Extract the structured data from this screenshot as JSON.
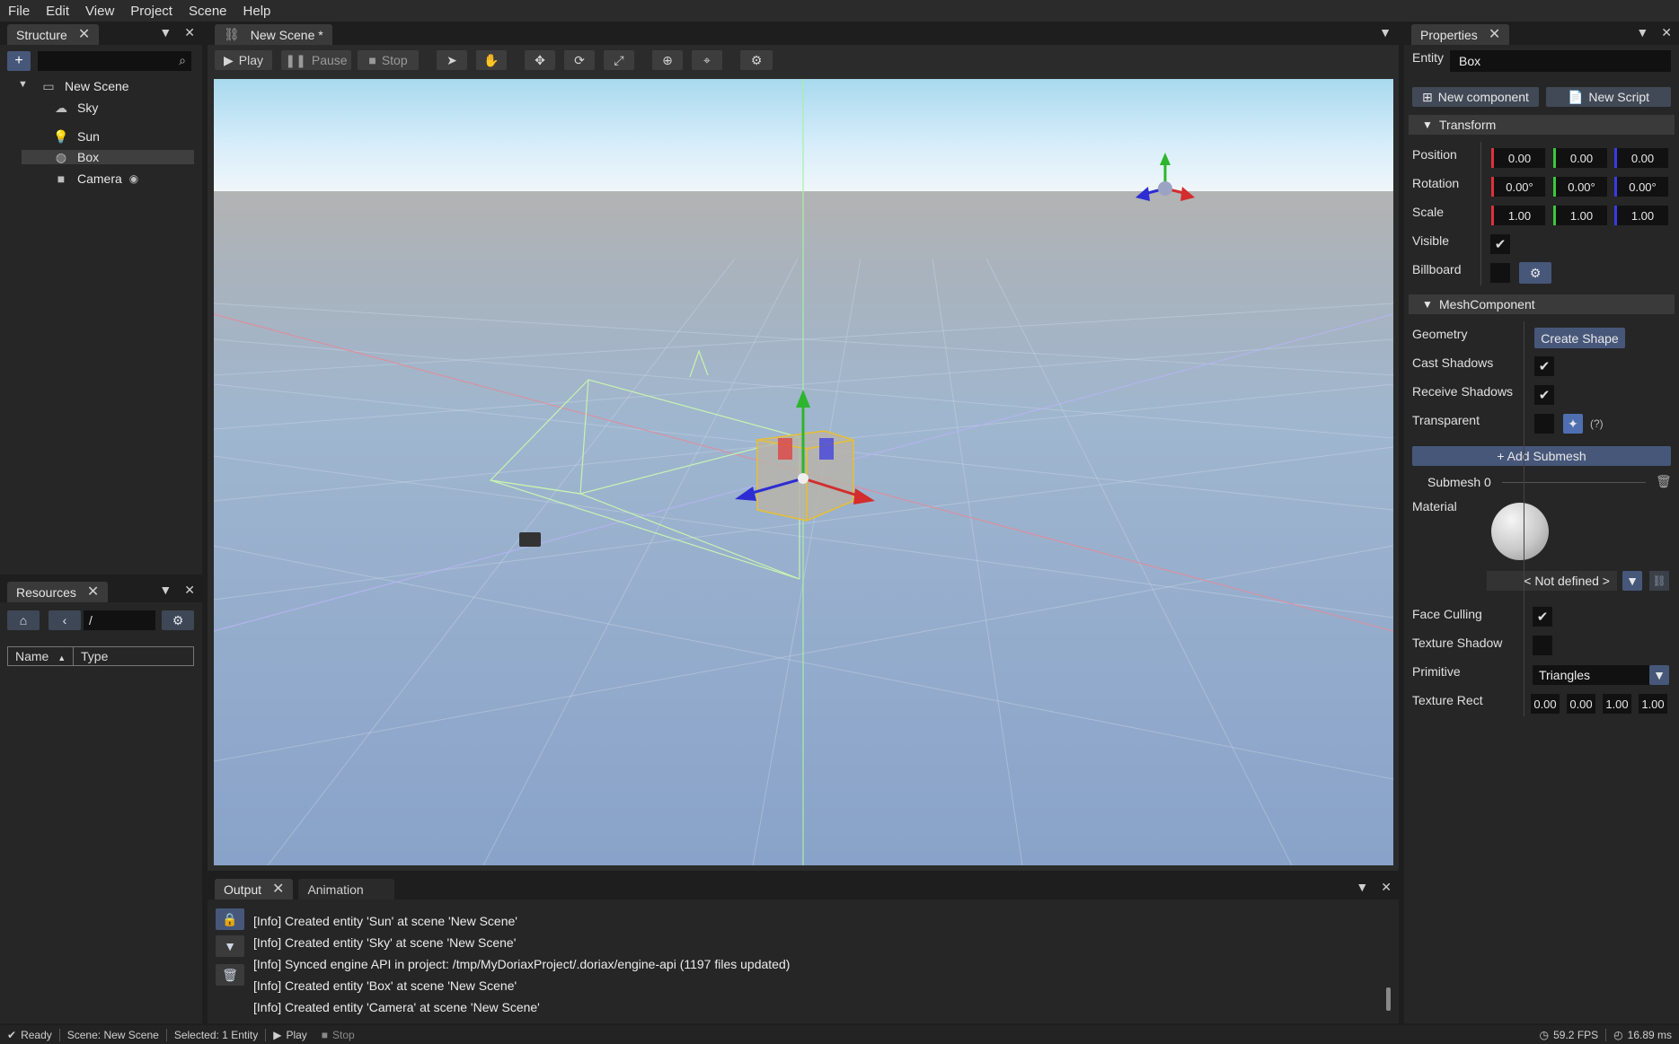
{
  "menu": [
    "File",
    "Edit",
    "View",
    "Project",
    "Scene",
    "Help"
  ],
  "structure": {
    "tab_label": "Structure",
    "add_label": "+",
    "search_placeholder": "",
    "tree": [
      {
        "label": "New Scene",
        "icon": "monitor-icon"
      },
      {
        "label": "Sky",
        "icon": "cloud-icon"
      },
      {
        "label": "Sun",
        "icon": "lightbulb-icon"
      },
      {
        "label": "Box",
        "icon": "mesh-icon",
        "selected": true
      },
      {
        "label": "Camera",
        "icon": "camera-icon"
      }
    ]
  },
  "resources": {
    "tab_label": "Resources",
    "path": "/",
    "columns": [
      "Name",
      "Type"
    ]
  },
  "scene": {
    "tab_label": "New Scene *",
    "toolbar": {
      "play": "Play",
      "pause": "Pause",
      "stop": "Stop"
    }
  },
  "output": {
    "tabs": [
      "Output",
      "Animation"
    ],
    "logs": [
      "[Info] Created entity 'Sun' at scene 'New Scene'",
      "[Info] Created entity 'Sky' at scene 'New Scene'",
      "[Info] Synced engine API in project: /tmp/MyDoriaxProject/.doriax/engine-api (1197 files updated)",
      "[Info] Created entity 'Box' at scene 'New Scene'",
      "[Info] Created entity 'Camera' at scene 'New Scene'"
    ]
  },
  "properties": {
    "tab_label": "Properties",
    "entity_label": "Entity",
    "entity_name": "Box",
    "new_component": "New component",
    "new_script": "New Script",
    "transform": {
      "title": "Transform",
      "position_label": "Position",
      "position": [
        "0.00",
        "0.00",
        "0.00"
      ],
      "rotation_label": "Rotation",
      "rotation": [
        "0.00°",
        "0.00°",
        "0.00°"
      ],
      "scale_label": "Scale",
      "scale": [
        "1.00",
        "1.00",
        "1.00"
      ],
      "visible_label": "Visible",
      "billboard_label": "Billboard"
    },
    "mesh": {
      "title": "MeshComponent",
      "geometry_label": "Geometry",
      "create_shape": "Create Shape",
      "cast_shadows_label": "Cast Shadows",
      "receive_shadows_label": "Receive Shadows",
      "transparent_label": "Transparent",
      "help": "(?)",
      "add_submesh": "+ Add Submesh",
      "submesh_title": "Submesh 0",
      "material_label": "Material",
      "material_value": "< Not defined >",
      "face_culling_label": "Face Culling",
      "texture_shadow_label": "Texture Shadow",
      "primitive_label": "Primitive",
      "primitive_value": "Triangles",
      "texture_rect_label": "Texture Rect",
      "texture_rect": [
        "0.00",
        "0.00",
        "1.00",
        "1.00"
      ]
    }
  },
  "status": {
    "ready": "Ready",
    "scene": "Scene: New Scene",
    "selected": "Selected: 1 Entity",
    "play": "Play",
    "stop": "Stop",
    "fps": "59.2 FPS",
    "ms": "16.89 ms"
  },
  "colors": {
    "accent": "#46577a",
    "axis_x": "#e0303a",
    "axis_y": "#3cc83c",
    "axis_z": "#3a3ae6"
  }
}
